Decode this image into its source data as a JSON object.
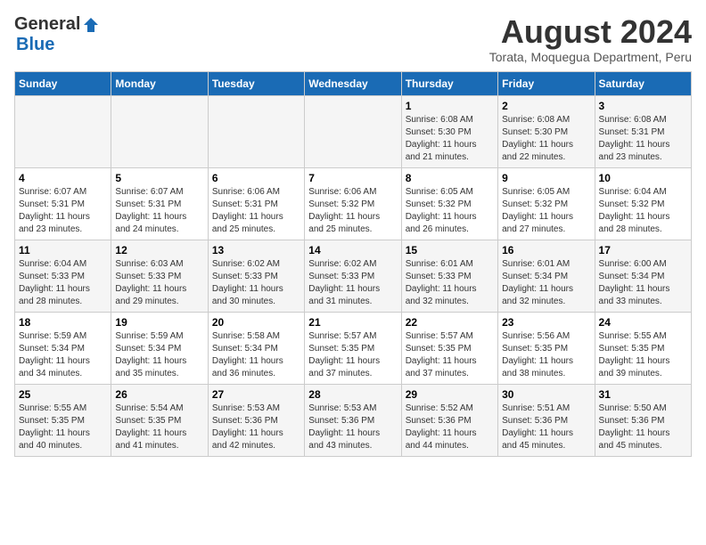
{
  "logo": {
    "general": "General",
    "blue": "Blue"
  },
  "header": {
    "title": "August 2024",
    "subtitle": "Torata, Moquegua Department, Peru"
  },
  "days_of_week": [
    "Sunday",
    "Monday",
    "Tuesday",
    "Wednesday",
    "Thursday",
    "Friday",
    "Saturday"
  ],
  "weeks": [
    [
      {
        "day": "",
        "info": ""
      },
      {
        "day": "",
        "info": ""
      },
      {
        "day": "",
        "info": ""
      },
      {
        "day": "",
        "info": ""
      },
      {
        "day": "1",
        "info": "Sunrise: 6:08 AM\nSunset: 5:30 PM\nDaylight: 11 hours\nand 21 minutes."
      },
      {
        "day": "2",
        "info": "Sunrise: 6:08 AM\nSunset: 5:30 PM\nDaylight: 11 hours\nand 22 minutes."
      },
      {
        "day": "3",
        "info": "Sunrise: 6:08 AM\nSunset: 5:31 PM\nDaylight: 11 hours\nand 23 minutes."
      }
    ],
    [
      {
        "day": "4",
        "info": "Sunrise: 6:07 AM\nSunset: 5:31 PM\nDaylight: 11 hours\nand 23 minutes."
      },
      {
        "day": "5",
        "info": "Sunrise: 6:07 AM\nSunset: 5:31 PM\nDaylight: 11 hours\nand 24 minutes."
      },
      {
        "day": "6",
        "info": "Sunrise: 6:06 AM\nSunset: 5:31 PM\nDaylight: 11 hours\nand 25 minutes."
      },
      {
        "day": "7",
        "info": "Sunrise: 6:06 AM\nSunset: 5:32 PM\nDaylight: 11 hours\nand 25 minutes."
      },
      {
        "day": "8",
        "info": "Sunrise: 6:05 AM\nSunset: 5:32 PM\nDaylight: 11 hours\nand 26 minutes."
      },
      {
        "day": "9",
        "info": "Sunrise: 6:05 AM\nSunset: 5:32 PM\nDaylight: 11 hours\nand 27 minutes."
      },
      {
        "day": "10",
        "info": "Sunrise: 6:04 AM\nSunset: 5:32 PM\nDaylight: 11 hours\nand 28 minutes."
      }
    ],
    [
      {
        "day": "11",
        "info": "Sunrise: 6:04 AM\nSunset: 5:33 PM\nDaylight: 11 hours\nand 28 minutes."
      },
      {
        "day": "12",
        "info": "Sunrise: 6:03 AM\nSunset: 5:33 PM\nDaylight: 11 hours\nand 29 minutes."
      },
      {
        "day": "13",
        "info": "Sunrise: 6:02 AM\nSunset: 5:33 PM\nDaylight: 11 hours\nand 30 minutes."
      },
      {
        "day": "14",
        "info": "Sunrise: 6:02 AM\nSunset: 5:33 PM\nDaylight: 11 hours\nand 31 minutes."
      },
      {
        "day": "15",
        "info": "Sunrise: 6:01 AM\nSunset: 5:33 PM\nDaylight: 11 hours\nand 32 minutes."
      },
      {
        "day": "16",
        "info": "Sunrise: 6:01 AM\nSunset: 5:34 PM\nDaylight: 11 hours\nand 32 minutes."
      },
      {
        "day": "17",
        "info": "Sunrise: 6:00 AM\nSunset: 5:34 PM\nDaylight: 11 hours\nand 33 minutes."
      }
    ],
    [
      {
        "day": "18",
        "info": "Sunrise: 5:59 AM\nSunset: 5:34 PM\nDaylight: 11 hours\nand 34 minutes."
      },
      {
        "day": "19",
        "info": "Sunrise: 5:59 AM\nSunset: 5:34 PM\nDaylight: 11 hours\nand 35 minutes."
      },
      {
        "day": "20",
        "info": "Sunrise: 5:58 AM\nSunset: 5:34 PM\nDaylight: 11 hours\nand 36 minutes."
      },
      {
        "day": "21",
        "info": "Sunrise: 5:57 AM\nSunset: 5:35 PM\nDaylight: 11 hours\nand 37 minutes."
      },
      {
        "day": "22",
        "info": "Sunrise: 5:57 AM\nSunset: 5:35 PM\nDaylight: 11 hours\nand 37 minutes."
      },
      {
        "day": "23",
        "info": "Sunrise: 5:56 AM\nSunset: 5:35 PM\nDaylight: 11 hours\nand 38 minutes."
      },
      {
        "day": "24",
        "info": "Sunrise: 5:55 AM\nSunset: 5:35 PM\nDaylight: 11 hours\nand 39 minutes."
      }
    ],
    [
      {
        "day": "25",
        "info": "Sunrise: 5:55 AM\nSunset: 5:35 PM\nDaylight: 11 hours\nand 40 minutes."
      },
      {
        "day": "26",
        "info": "Sunrise: 5:54 AM\nSunset: 5:35 PM\nDaylight: 11 hours\nand 41 minutes."
      },
      {
        "day": "27",
        "info": "Sunrise: 5:53 AM\nSunset: 5:36 PM\nDaylight: 11 hours\nand 42 minutes."
      },
      {
        "day": "28",
        "info": "Sunrise: 5:53 AM\nSunset: 5:36 PM\nDaylight: 11 hours\nand 43 minutes."
      },
      {
        "day": "29",
        "info": "Sunrise: 5:52 AM\nSunset: 5:36 PM\nDaylight: 11 hours\nand 44 minutes."
      },
      {
        "day": "30",
        "info": "Sunrise: 5:51 AM\nSunset: 5:36 PM\nDaylight: 11 hours\nand 45 minutes."
      },
      {
        "day": "31",
        "info": "Sunrise: 5:50 AM\nSunset: 5:36 PM\nDaylight: 11 hours\nand 45 minutes."
      }
    ]
  ]
}
